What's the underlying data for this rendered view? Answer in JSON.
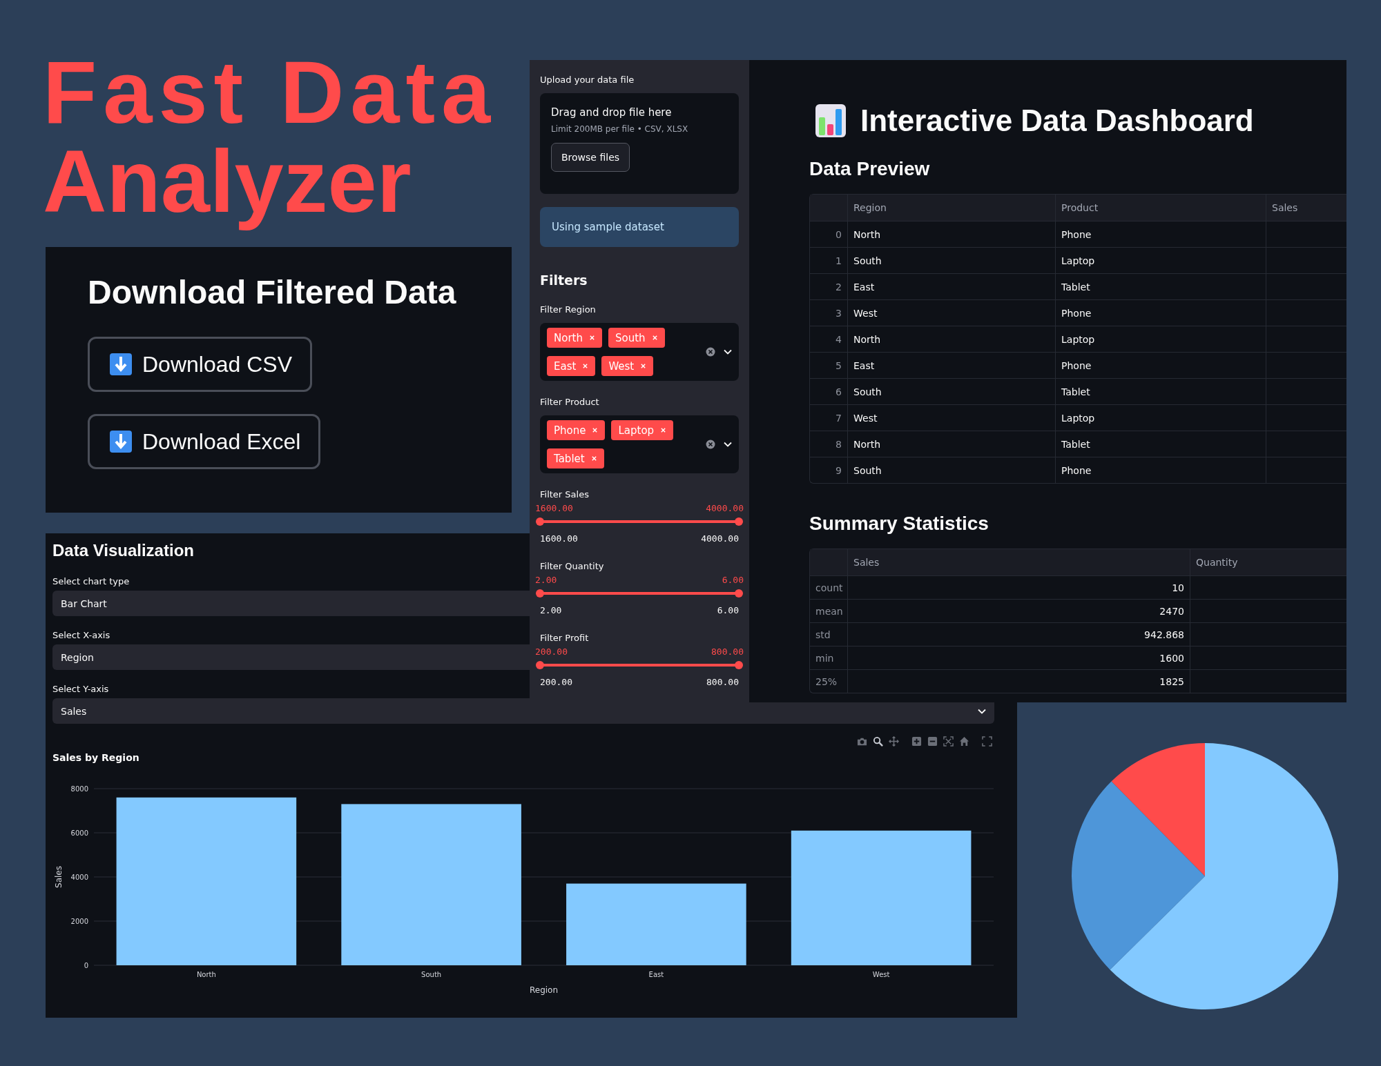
{
  "poster_title": [
    "Fast Data",
    "Analyzer"
  ],
  "download_panel": {
    "heading": "Download Filtered Data",
    "buttons": [
      "Download CSV",
      "Download Excel"
    ]
  },
  "sidebar": {
    "upload": {
      "label": "Upload your data file",
      "drop_text": "Drag and drop file here",
      "limit": "Limit 200MB per file • CSV, XLSX",
      "button": "Browse files"
    },
    "info": "Using sample dataset",
    "filters_heading": "Filters",
    "multiselects": [
      {
        "label": "Filter Region",
        "tags": [
          "North",
          "South",
          "East",
          "West"
        ]
      },
      {
        "label": "Filter Product",
        "tags": [
          "Phone",
          "Laptop",
          "Tablet"
        ]
      }
    ],
    "sliders": [
      {
        "label": "Filter Sales",
        "level": 1,
        "low": "1600.00",
        "high": "4000.00",
        "min": "1600.00",
        "max": "4000.00"
      },
      {
        "label": "Filter Quantity",
        "level": 1,
        "low": "2.00",
        "high": "6.00",
        "min": "2.00",
        "max": "6.00"
      },
      {
        "label": "Filter Profit",
        "level": 1,
        "low": "200.00",
        "high": "800.00",
        "min": "200.00",
        "max": "800.00"
      }
    ]
  },
  "main": {
    "title": "Interactive Data Dashboard",
    "preview_heading": "Data Preview",
    "preview_table": {
      "columns": [
        "Region",
        "Product",
        "Sales"
      ],
      "rows": [
        {
          "index": "0",
          "cells": [
            "North",
            "Phone"
          ]
        },
        {
          "index": "1",
          "cells": [
            "South",
            "Laptop"
          ]
        },
        {
          "index": "2",
          "cells": [
            "East",
            "Tablet"
          ]
        },
        {
          "index": "3",
          "cells": [
            "West",
            "Phone"
          ]
        },
        {
          "index": "4",
          "cells": [
            "North",
            "Laptop"
          ]
        },
        {
          "index": "5",
          "cells": [
            "East",
            "Phone"
          ]
        },
        {
          "index": "6",
          "cells": [
            "South",
            "Tablet"
          ]
        },
        {
          "index": "7",
          "cells": [
            "West",
            "Laptop"
          ]
        },
        {
          "index": "8",
          "cells": [
            "North",
            "Tablet"
          ]
        },
        {
          "index": "9",
          "cells": [
            "South",
            "Phone"
          ]
        }
      ]
    },
    "summary_heading": "Summary Statistics",
    "summary_table": {
      "columns": [
        "Sales",
        "Quantity"
      ],
      "rows": [
        {
          "stat": "count",
          "cells": [
            "10"
          ]
        },
        {
          "stat": "mean",
          "cells": [
            "2470"
          ]
        },
        {
          "stat": "std",
          "cells": [
            "942.868"
          ]
        },
        {
          "stat": "min",
          "cells": [
            "1600"
          ]
        },
        {
          "stat": "25%",
          "cells": [
            "1825"
          ]
        }
      ]
    }
  },
  "visualization": {
    "heading": "Data Visualization",
    "selects": [
      {
        "label": "Select chart type",
        "value": "Bar Chart"
      },
      {
        "label": "Select X-axis",
        "value": "Region"
      },
      {
        "label": "Select Y-axis",
        "value": "Sales"
      }
    ],
    "chart_data": {
      "type": "bar",
      "title": "Sales by Region",
      "xlabel": "Region",
      "ylabel": "Sales",
      "categories": [
        "North",
        "South",
        "East",
        "West"
      ],
      "values": [
        7600,
        7300,
        3700,
        6100
      ],
      "ylim": [
        0,
        8000
      ],
      "yticks": [
        0,
        2000,
        4000,
        6000,
        8000
      ],
      "grid": true
    }
  }
}
